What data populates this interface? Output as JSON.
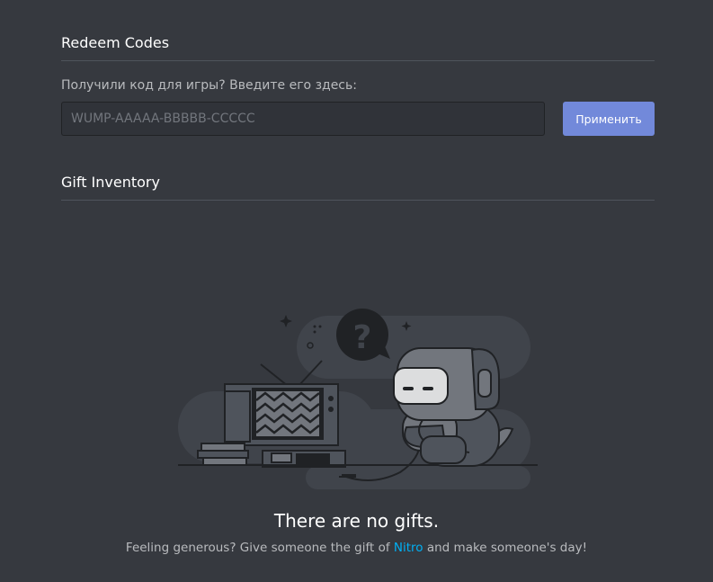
{
  "redeem": {
    "title": "Redeem Codes",
    "label": "Получили код для игры? Введите его здесь:",
    "placeholder": "WUMP-AAAAA-BBBBB-CCCCC",
    "value": "",
    "button_label": "Применить"
  },
  "gift_inventory": {
    "title": "Gift Inventory",
    "empty_title": "There are no gifts.",
    "empty_sub_before": "Feeling generous? Give someone the gift of ",
    "empty_sub_link": "Nitro",
    "empty_sub_after": " and make someone's day!"
  },
  "colors": {
    "background": "#36393f",
    "accent": "#7289da",
    "link": "#00b0f4"
  }
}
